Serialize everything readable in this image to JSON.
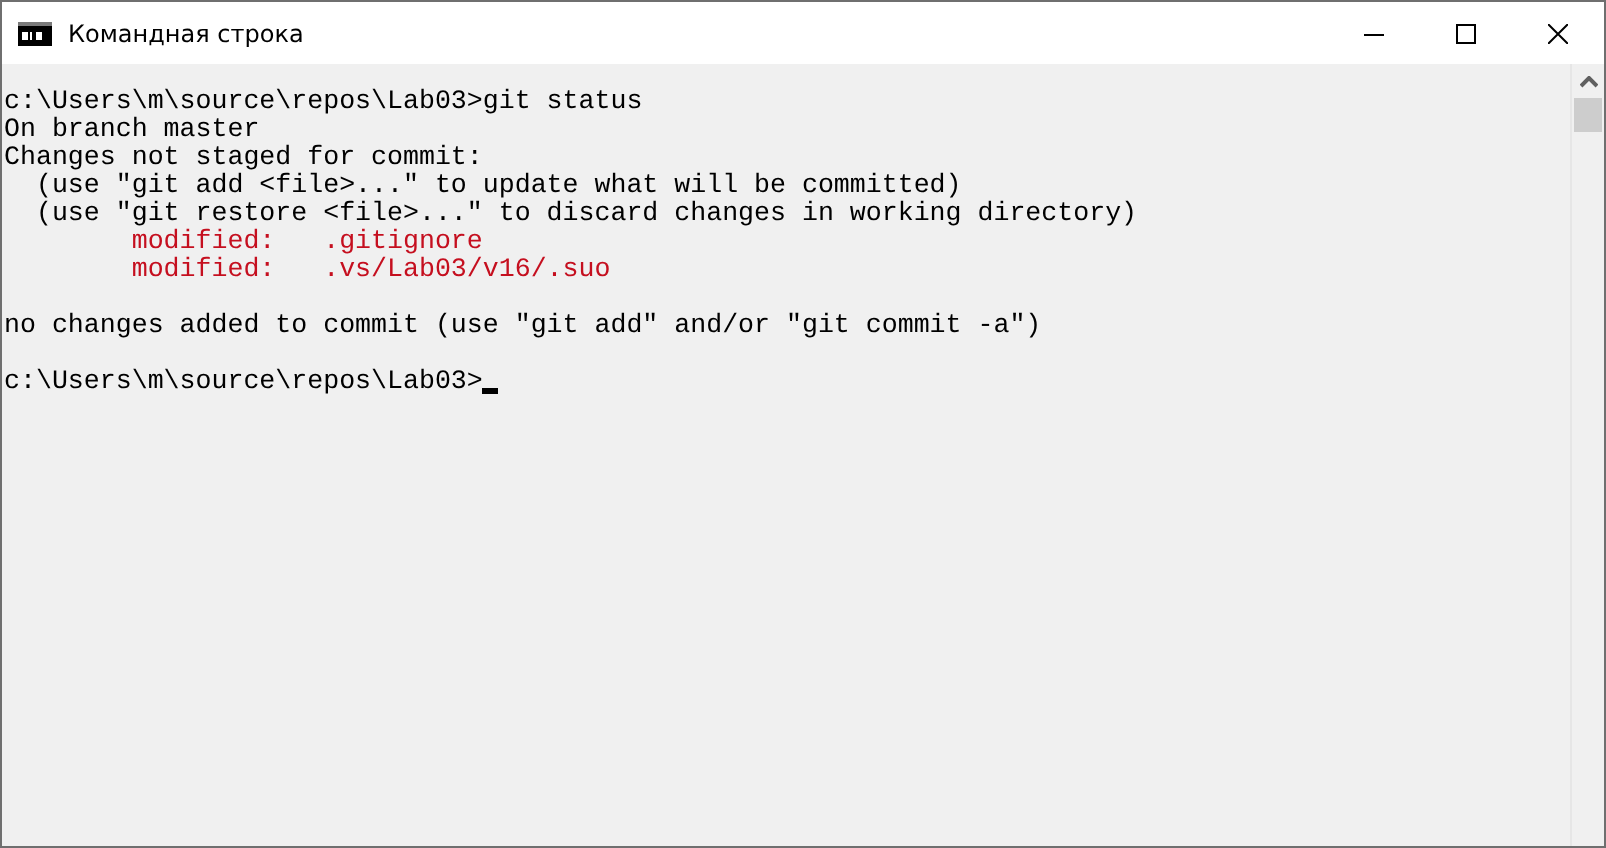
{
  "window": {
    "title": "Командная строка"
  },
  "console": {
    "lines": [
      {
        "kind": "text",
        "segments": [
          {
            "text": "c:\\Users\\m\\source\\repos\\Lab03>git status",
            "modified": false
          }
        ]
      },
      {
        "kind": "text",
        "segments": [
          {
            "text": "On branch master",
            "modified": false
          }
        ]
      },
      {
        "kind": "text",
        "segments": [
          {
            "text": "Changes not staged for commit:",
            "modified": false
          }
        ]
      },
      {
        "kind": "text",
        "segments": [
          {
            "text": "  (use \"git add <file>...\" to update what will be committed)",
            "modified": false
          }
        ]
      },
      {
        "kind": "text",
        "segments": [
          {
            "text": "  (use \"git restore <file>...\" to discard changes in working directory)",
            "modified": false
          }
        ]
      },
      {
        "kind": "text",
        "segments": [
          {
            "text": "        modified:   .gitignore",
            "modified": true
          }
        ]
      },
      {
        "kind": "text",
        "segments": [
          {
            "text": "        modified:   .vs/Lab03/v16/.suo",
            "modified": true
          }
        ]
      },
      {
        "kind": "blank"
      },
      {
        "kind": "text",
        "segments": [
          {
            "text": "no changes added to commit (use \"git add\" and/or \"git commit -a\")",
            "modified": false
          }
        ]
      },
      {
        "kind": "blank"
      },
      {
        "kind": "prompt",
        "segments": [
          {
            "text": "c:\\Users\\m\\source\\repos\\Lab03>",
            "modified": false
          }
        ]
      }
    ]
  }
}
